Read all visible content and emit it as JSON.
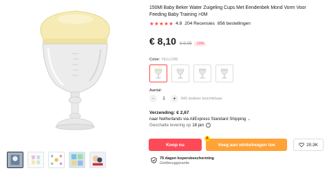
{
  "product": {
    "title": "150Ml Baby Beker Water Zuigeling Cups Met Eendenbek Mond Vorm Voor Feeding Baby Training >0M",
    "stars": "★★★★★",
    "rating": "4.8",
    "reviews": "204 Recensies",
    "orders": "856 bestellingen"
  },
  "price": {
    "current": "€ 8,10",
    "original": "€ 9,05",
    "discount": "-10%"
  },
  "color": {
    "label": "Color:",
    "value": "YELLOW",
    "options": [
      "yellow",
      "white",
      "blue",
      "green"
    ]
  },
  "quantity": {
    "label": "Aantal:",
    "value": "1",
    "minus": "−",
    "plus": "+",
    "stock": "842 stukken beschikbaar"
  },
  "shipping": {
    "title": "Verzending: € 2,67",
    "line": "naar Netherlands via AliExpress Standard Shipping",
    "chevron": "⌄",
    "delivery_label": "Geschatte levering op",
    "delivery_date": "18 jan",
    "help": "?"
  },
  "actions": {
    "buy_label": "Koop nu",
    "cart_label": "Voeg aan winkelwagen toe",
    "cart_badge": "A",
    "wish_count": "20.3K"
  },
  "protection": {
    "title": "75 dagen kopersbescherming",
    "subtitle": "Geldteruggarantie"
  },
  "colors": {
    "accent_red": "#fe4a57",
    "accent_orange": "#ffa238",
    "star_red": "#ff4747",
    "lid_yellow": "#f7ecb0"
  },
  "icons": [
    "heart-icon",
    "shield-check-icon",
    "help-icon"
  ]
}
